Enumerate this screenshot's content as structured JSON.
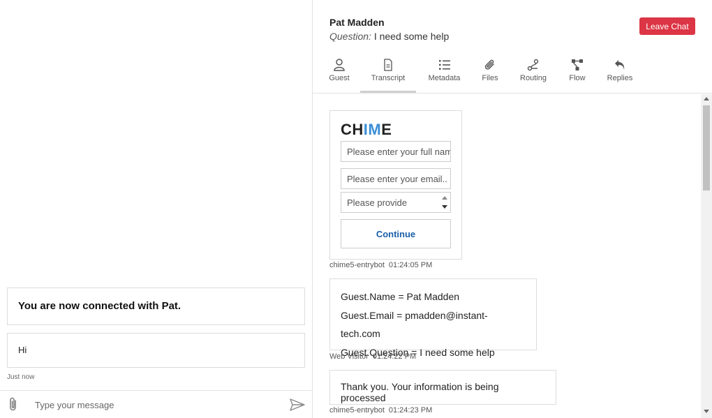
{
  "left": {
    "connected_message": "You are now connected with Pat.",
    "hi_message": "Hi",
    "hi_time": "Just now",
    "composer": {
      "placeholder": "Type your message"
    }
  },
  "header": {
    "guest_name": "Pat Madden",
    "question_label": "Question:",
    "question_text": " I need some help",
    "leave_button": "Leave Chat",
    "leave_color": "#dc3545"
  },
  "tabs": [
    {
      "label": "Guest",
      "icon": "user-icon"
    },
    {
      "label": "Transcript",
      "icon": "document-icon",
      "active": true
    },
    {
      "label": "Metadata",
      "icon": "list-icon"
    },
    {
      "label": "Files",
      "icon": "paperclip-icon"
    },
    {
      "label": "Routing",
      "icon": "routing-icon"
    },
    {
      "label": "Flow",
      "icon": "flow-icon"
    },
    {
      "label": "Replies",
      "icon": "reply-icon"
    }
  ],
  "transcript": {
    "form": {
      "logo_dark_1": "CH",
      "logo_blue": "IM",
      "logo_dark_2": "E",
      "name_placeholder": "Please enter your full name",
      "email_placeholder": "Please enter your email..",
      "question_placeholder": "Please provide",
      "continue_label": "Continue",
      "sender": "chime5-entrybot",
      "time": "01:24:05 PM"
    },
    "vars": {
      "line1": "Guest.Name = Pat Madden",
      "line2": "Guest.Email = pmadden@instant-tech.com",
      "line3": "Guest.Question = I need some help",
      "sender": "Web Visitor",
      "time": "01:24:22 PM"
    },
    "info": {
      "text": "Thank you. Your information is being processed",
      "sender": "chime5-entrybot",
      "time": "01:24:23 PM"
    }
  }
}
